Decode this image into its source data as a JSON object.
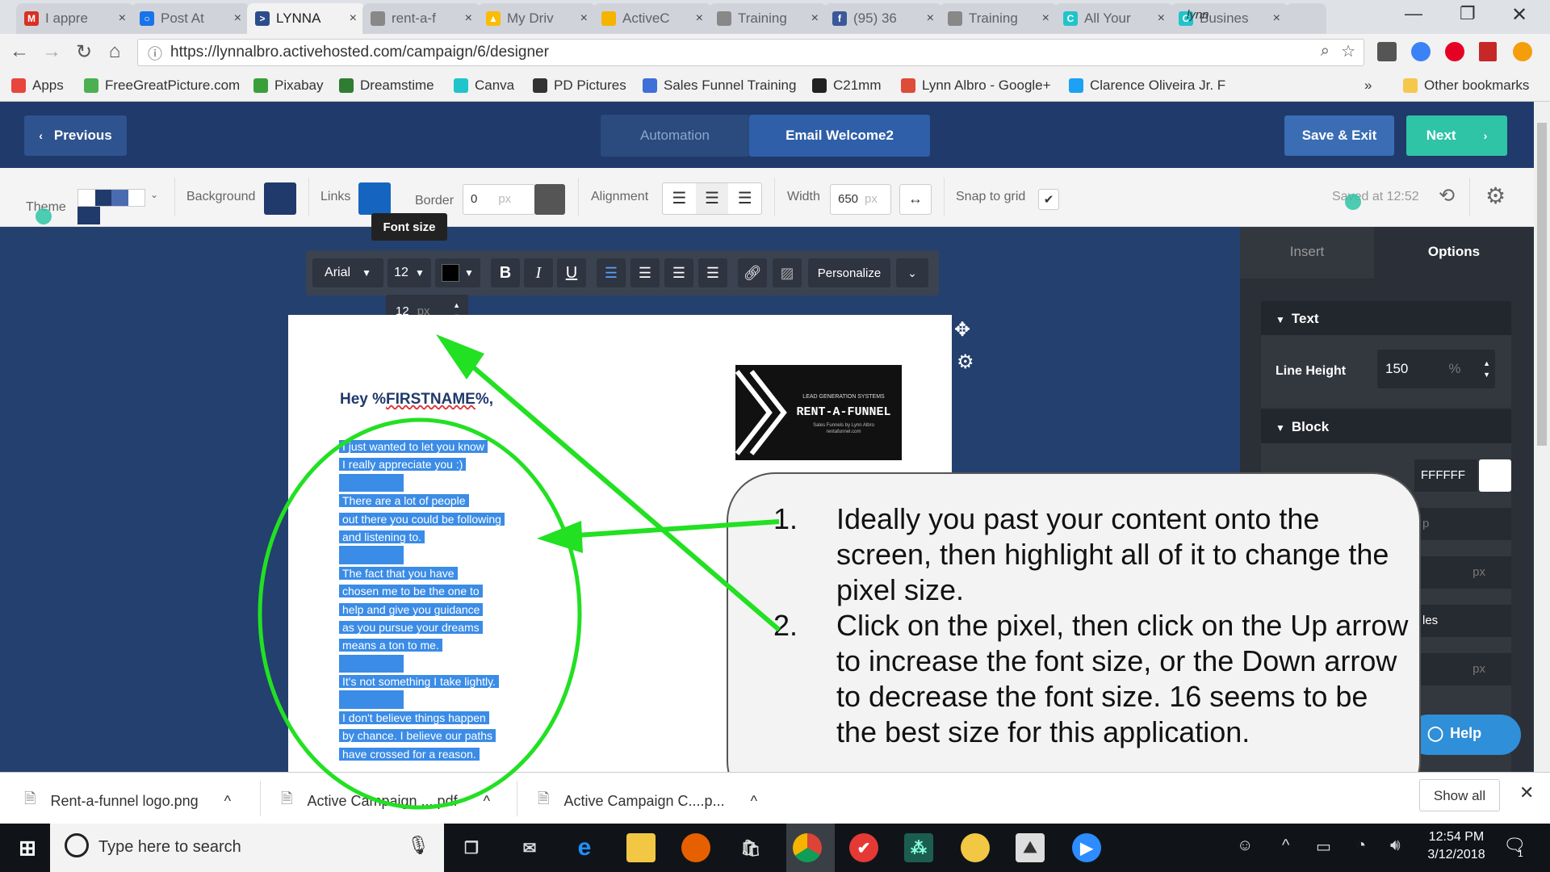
{
  "browser": {
    "tabs": [
      {
        "label": "I appre",
        "icon": "gmail-icon",
        "color": "#d93025",
        "glyph": "M"
      },
      {
        "label": "Post At",
        "icon": "circle-icon",
        "color": "#1a73e8",
        "glyph": "○"
      },
      {
        "label": "LYNNA",
        "icon": "activecampaign-icon",
        "color": "#2c4d8a",
        "glyph": ">"
      },
      {
        "label": "rent-a-f",
        "icon": "page-icon",
        "color": "#888888",
        "glyph": ""
      },
      {
        "label": "My Driv",
        "icon": "drive-icon",
        "color": "#fbbc04",
        "glyph": "▲"
      },
      {
        "label": "ActiveC",
        "icon": "slides-icon",
        "color": "#f4b400",
        "glyph": ""
      },
      {
        "label": "Training",
        "icon": "page-icon",
        "color": "#888888",
        "glyph": ""
      },
      {
        "label": "(95) 36",
        "icon": "facebook-icon",
        "color": "#3b5998",
        "glyph": "f"
      },
      {
        "label": "Training",
        "icon": "page-icon",
        "color": "#888888",
        "glyph": ""
      },
      {
        "label": "All Your",
        "icon": "canva-icon",
        "color": "#20c4cb",
        "glyph": "C"
      },
      {
        "label": "Busines",
        "icon": "canva-icon",
        "color": "#20c4cb",
        "glyph": "C"
      }
    ],
    "profile_name": "lynn",
    "url": "https://lynnalbro.activehosted.com/campaign/6/designer",
    "bookmarks": [
      {
        "label": "Apps",
        "color": "#e8453c"
      },
      {
        "label": "FreeGreatPicture.com",
        "color": "#4caf50"
      },
      {
        "label": "Pixabay",
        "color": "#3a9f3a"
      },
      {
        "label": "Dreamstime",
        "color": "#2e7d32"
      },
      {
        "label": "Canva",
        "color": "#20c4cb"
      },
      {
        "label": "PD Pictures",
        "color": "#333333"
      },
      {
        "label": "Sales Funnel Training",
        "color": "#3f6fd8"
      },
      {
        "label": "C21mm",
        "color": "#222222"
      },
      {
        "label": "Lynn Albro - Google+",
        "color": "#dd4b39"
      },
      {
        "label": "Clarence Oliveira Jr. F",
        "color": "#1da1f2"
      }
    ],
    "more_bookmarks": "»",
    "other_bookmarks": "Other bookmarks"
  },
  "header": {
    "previous_label": "Previous",
    "tab_automation": "Automation",
    "tab_email": "Email Welcome2",
    "save_exit_label": "Save & Exit",
    "next_label": "Next"
  },
  "toolbar": {
    "theme_label": "Theme",
    "background_label": "Background",
    "background_color": "#1f3a6b",
    "links_label": "Links",
    "links_color": "#1565c0",
    "border_label": "Border",
    "border_value": "0",
    "border_unit": "px",
    "alignment_label": "Alignment",
    "width_label": "Width",
    "width_value": "650",
    "width_unit": "px",
    "snap_label": "Snap to grid",
    "saved_status": "Saved at 12:52"
  },
  "format_bar": {
    "tooltip": "Font size",
    "font_family": "Arial",
    "font_size": "12",
    "size_input_value": "12",
    "size_input_unit": "px",
    "personalize_label": "Personalize"
  },
  "email": {
    "greeting_prefix": "Hey %",
    "greeting_tag": "FIRSTNAME",
    "greeting_suffix": "%,",
    "lines": [
      "I just wanted to let you know",
      "I really appreciate you :)",
      "",
      "There are a lot of people",
      "out there you could be following",
      "and listening to.",
      "",
      "The fact that you have",
      "chosen me to be the one to",
      "help and give you guidance",
      "as you pursue your dreams",
      "means a ton to me.",
      "",
      "It's not something I take lightly.",
      "",
      "I don't believe things happen",
      "by chance. I believe our paths",
      "have crossed for a reason."
    ],
    "logo_small": "LEAD GENERATION SYSTEMS",
    "logo_title": "RENT-A-FUNNEL",
    "logo_sub1": "Sales Funnels by Lynn Albro",
    "logo_sub2": "rentafunnel.com"
  },
  "sidepanel": {
    "tab_insert": "Insert",
    "tab_options": "Options",
    "text_section": "Text",
    "line_height_label": "Line Height",
    "line_height_value": "150",
    "line_height_unit": "%",
    "block_section": "Block",
    "block_color_value": "FFFFFF",
    "partial_unit_1": "p",
    "partial_unit_2": "px",
    "partial_label": "les",
    "partial_unit_3": "px",
    "help_label": "Help"
  },
  "callout": {
    "steps": [
      {
        "num": "1.",
        "text": "Ideally you past your content onto the screen, then highlight all of it to change the pixel size."
      },
      {
        "num": "2.",
        "text": "Click on the pixel, then click on the Up arrow to increase the font size, or the Down arrow to decrease the font size. 16 seems to be the best size for this application."
      }
    ]
  },
  "downloads": {
    "items": [
      "Rent-a-funnel logo.png",
      "Active Campaign ....pdf",
      "Active Campaign C....p..."
    ],
    "show_all": "Show all"
  },
  "taskbar": {
    "search_placeholder": "Type here to search",
    "time": "12:54 PM",
    "date": "3/12/2018",
    "notification_count": "1"
  }
}
